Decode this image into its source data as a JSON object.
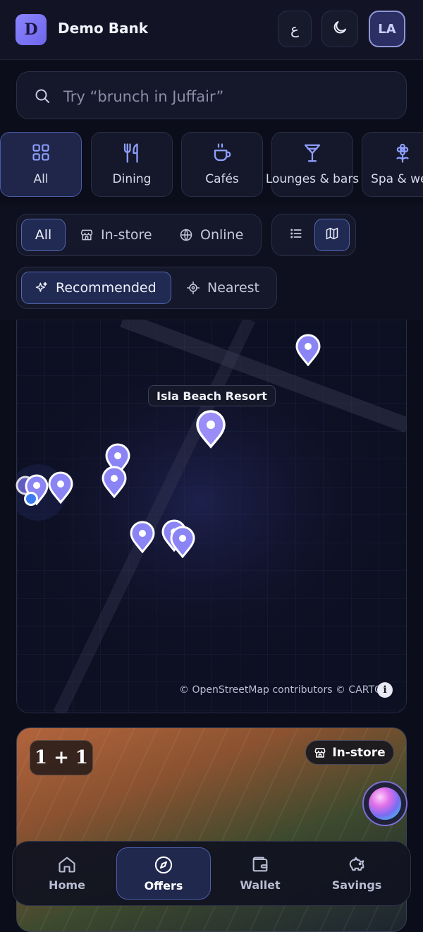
{
  "header": {
    "logo_letter": "D",
    "app_name": "Demo Bank",
    "lang_label": "ع",
    "avatar_initials": "LA"
  },
  "search": {
    "placeholder": "Try “brunch in Juffair”",
    "value": ""
  },
  "categories": [
    {
      "label": "All",
      "icon": "grid-icon",
      "active": true
    },
    {
      "label": "Dining",
      "icon": "utensils-icon",
      "active": false
    },
    {
      "label": "Cafés",
      "icon": "coffee-cup-icon",
      "active": false
    },
    {
      "label": "Lounges & bars",
      "icon": "cocktail-icon",
      "active": false
    },
    {
      "label": "Spa & well",
      "icon": "flower-icon",
      "active": false
    }
  ],
  "channel_filter": {
    "options": [
      {
        "label": "All",
        "icon": "",
        "active": true
      },
      {
        "label": "In-store",
        "icon": "store-icon",
        "active": false
      },
      {
        "label": "Online",
        "icon": "globe-icon",
        "active": false
      }
    ]
  },
  "view_toggle": {
    "options": [
      {
        "name": "list-view",
        "icon": "list-icon",
        "active": false
      },
      {
        "name": "map-view",
        "icon": "map-icon",
        "active": true
      }
    ]
  },
  "sort_filter": {
    "options": [
      {
        "label": "Recommended",
        "icon": "sparkles-icon",
        "active": true
      },
      {
        "label": "Nearest",
        "icon": "crosshair-icon",
        "active": false
      }
    ]
  },
  "map": {
    "selected_place_label": "Isla Beach Resort",
    "attribution": "© OpenStreetMap contributors © CARTO",
    "info_label": "i"
  },
  "offer_card": {
    "deal_badge": "1 + 1",
    "channel_badge": "In-store"
  },
  "bottom_nav": {
    "items": [
      {
        "label": "Home",
        "icon": "home-icon",
        "active": false
      },
      {
        "label": "Offers",
        "icon": "compass-icon",
        "active": true
      },
      {
        "label": "Wallet",
        "icon": "wallet-icon",
        "active": false
      },
      {
        "label": "Savings",
        "icon": "piggy-bank-icon",
        "active": false
      }
    ]
  },
  "colors": {
    "background": "#0b0d1a",
    "accent": "#7b73f0",
    "active_border": "#5366b0",
    "pin": "#8b84f5"
  }
}
